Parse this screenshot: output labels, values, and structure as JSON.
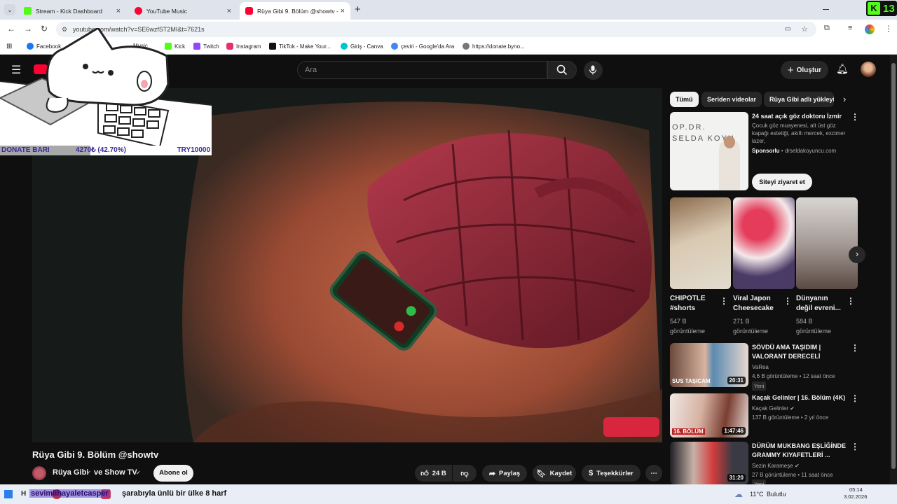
{
  "browser": {
    "tabs": [
      {
        "title": "Stream - Kick Dashboard",
        "favicon_color": "#53fc18"
      },
      {
        "title": "YouTube Music",
        "favicon_color": "#ff0033"
      },
      {
        "title": "Rüya Gibi 9. Bölüm @showtv -",
        "favicon_color": "#ff0033"
      }
    ],
    "new_tab_symbol": "+",
    "close_symbol": "×",
    "url": "youtube.com/watch?v=SE6wzfST2MI&t=7621s",
    "bookmarks": [
      {
        "label": "Facebook",
        "color": "#1877f2"
      },
      {
        "label": "Music",
        "color": "#ff0033"
      },
      {
        "label": "Kick",
        "color": "#53fc18"
      },
      {
        "label": "Twitch",
        "color": "#9146ff"
      },
      {
        "label": "Instagram",
        "color": "#e1306c"
      },
      {
        "label": "TikTok - Make Your...",
        "color": "#111111"
      },
      {
        "label": "Giriş - Canva",
        "color": "#00c4cc"
      },
      {
        "label": "çeviri - Google'da Ara",
        "color": "#4285f4"
      },
      {
        "label": "https://donate.byno...",
        "color": "#777777"
      }
    ],
    "kick_badge": "13"
  },
  "youtube": {
    "search_placeholder": "Ara",
    "create_label": "Oluştur",
    "video": {
      "title": "Rüya Gibi 9. Bölüm @showtv",
      "channel": "Rüya Gibi",
      "channel_collab": "ve Show TV",
      "subscribe_label": "Abone ol",
      "likes": "24 B",
      "share_label": "Paylaş",
      "save_label": "Kaydet",
      "thanks_label": "Teşekkürler"
    },
    "chips": [
      "Tümü",
      "Seriden videolar",
      "Rüya Gibi adlı yükleyic"
    ],
    "ad": {
      "title": "24 saat açık göz doktoru İzmir",
      "description": "Çocuk göz muayenesi, alt üst göz kapağı estetiği, akıllı mercek, excimer lazer,",
      "sponsor_label": "Sponsorlu",
      "domain": "drseldakoyuncu.com",
      "cta": "Siteyi ziyaret et",
      "thumb_text_1": "OP.DR.",
      "thumb_text_2": "SELDA KOYU"
    },
    "shorts": [
      {
        "title": "CHIPOTLE #shorts",
        "views": "547 B görüntüleme"
      },
      {
        "title": "Viral Japon Cheesecake",
        "views": "271 B görüntüleme"
      },
      {
        "title": "Dünyanın değil evreni...",
        "views": "584 B görüntüleme"
      }
    ],
    "related": [
      {
        "title": "SÖVDÜ AMA TAŞIDIM | VALORANT DERECELİ",
        "channel": "VaRea",
        "meta": "4,6 B görüntüleme • 12 saat önce",
        "badge": "Yeni",
        "duration": "20:31",
        "thumb_text": "SUS TAŞICAM",
        "verified": false
      },
      {
        "title": "Kaçak Gelinler | 16. Bölüm (4K)",
        "channel": "Kaçak Gelinler",
        "meta": "137 B görüntüleme • 2 yıl önce",
        "badge": "",
        "duration": "1:47:46",
        "thumb_text": "16. BÖLÜM",
        "verified": true
      },
      {
        "title": "DÜRÜM MUKBANG EŞLİĞİNDE GRAMMY KIYAFETLERİ ...",
        "channel": "Sezin Karameşe",
        "meta": "27 B görüntüleme • 11 saat önce",
        "badge": "Yeni",
        "duration": "31:20",
        "thumb_text": "",
        "verified": true
      }
    ]
  },
  "overlay": {
    "donate_label": "DONATE BARI",
    "donate_amount": "4270₺ (42.70%)",
    "donate_goal": "TRY10000",
    "donate_progress": 0.427
  },
  "taskbar": {
    "ticker_prefix": "H",
    "ticker_user": "sevimlihayaletcasper",
    "ticker_text": "şarabıyla ünlü bir ülke 8 harf",
    "weather": "11°C",
    "weather_desc": "Bulutlu",
    "time": "05:14",
    "date": "3.02.2026"
  }
}
